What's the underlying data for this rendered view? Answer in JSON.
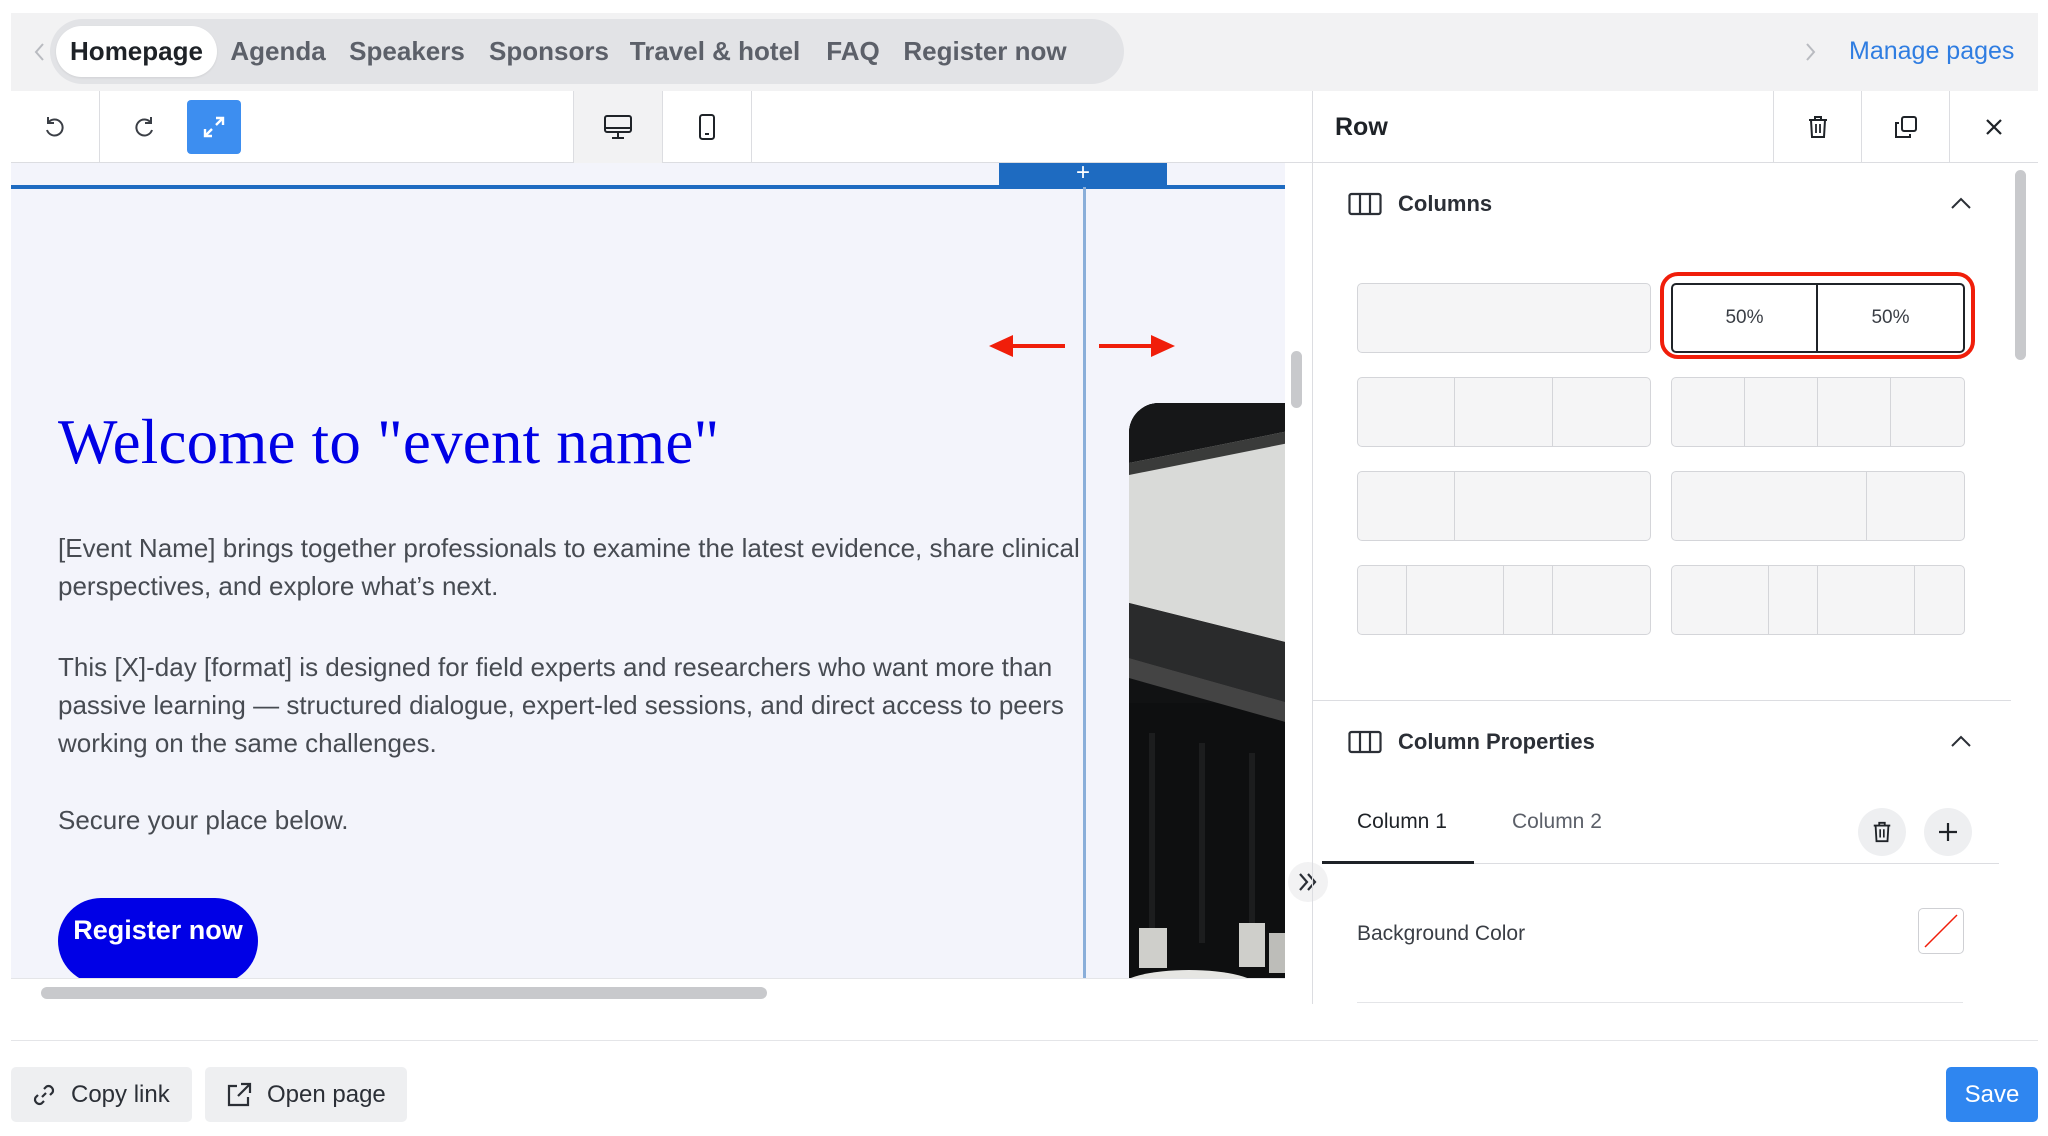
{
  "nav": {
    "tabs": [
      {
        "label": "Homepage"
      },
      {
        "label": "Agenda"
      },
      {
        "label": "Speakers"
      },
      {
        "label": "Sponsors"
      },
      {
        "label": "Travel & hotel"
      },
      {
        "label": "FAQ"
      },
      {
        "label": "Register now"
      }
    ],
    "active_tab": "Homepage",
    "manage_pages": "Manage pages"
  },
  "toolbar": {
    "icons": [
      "undo-icon",
      "redo-icon",
      "expand-icon",
      "desktop-icon",
      "mobile-icon"
    ]
  },
  "canvas": {
    "add_symbol": "+",
    "title": "Welcome to \"event name\"",
    "paragraphs": [
      "[Event Name] brings together professionals to examine the latest evidence, share clinical perspectives, and explore what’s next.",
      "This [X]-day [format] is designed for field experts and researchers who want more than passive learning — structured dialogue, expert-led sessions, and direct access to peers working on the same challenges.",
      "Secure your place below."
    ],
    "cta": "Register now",
    "accent_color": "#0000e6"
  },
  "panel": {
    "title": "Row",
    "header_icons": [
      "trash-icon",
      "duplicate-icon",
      "close-icon"
    ],
    "columns_section": {
      "title": "Columns",
      "selected_layout": {
        "labels": [
          "50%",
          "50%"
        ]
      }
    },
    "column_properties": {
      "title": "Column Properties",
      "tabs": [
        "Column 1",
        "Column 2"
      ],
      "active_tab": "Column 1",
      "background_label": "Background Color"
    }
  },
  "footer": {
    "copy_link": "Copy link",
    "open_page": "Open page",
    "save": "Save"
  },
  "colors": {
    "primary_blue": "#2f86f0",
    "highlight_red": "#f01e0a",
    "selection_blue": "#1e6bc1"
  }
}
